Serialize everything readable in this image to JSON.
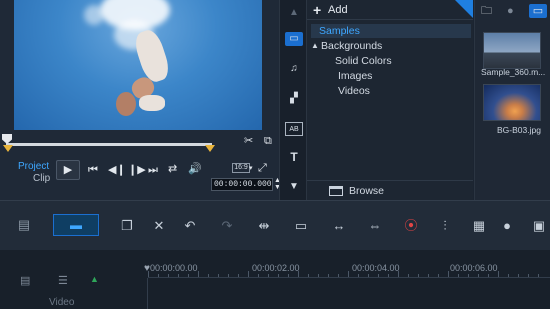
{
  "preview": {
    "mode_project": "Project",
    "mode_clip": "Clip",
    "aspect_ratio": "16:9",
    "timecode": "00:00:00.000"
  },
  "library": {
    "add_label": "Add",
    "tree": {
      "samples": "Samples",
      "backgrounds": "Backgrounds",
      "children": [
        "Solid Colors",
        "Images",
        "Videos"
      ]
    },
    "browse_label": "Browse"
  },
  "thumbnails": [
    {
      "caption": "Sample_360.m..."
    },
    {
      "caption": "BG-B03.jpg"
    }
  ],
  "timeline": {
    "ruler_labels": [
      "00:00:00.00",
      "00:00:02.00",
      "00:00:04.00",
      "00:00:06.00"
    ],
    "video_track_label": "Video"
  },
  "colors": {
    "accent": "#3ea7ff",
    "trim_marker": "#e8b43c",
    "selected_bg": "#1b6fd0"
  }
}
